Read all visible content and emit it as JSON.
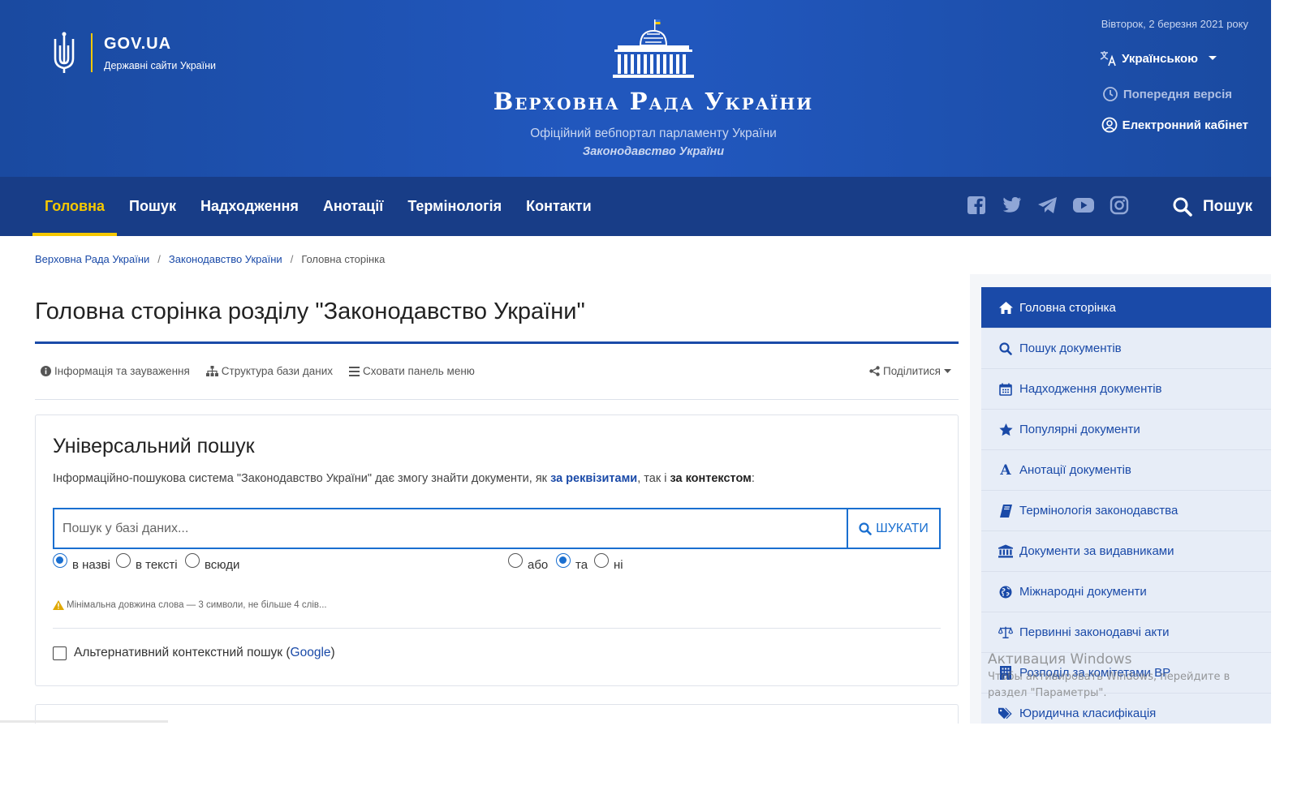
{
  "header": {
    "govua_title": "GOV.UA",
    "govua_subtitle": "Державні сайти України",
    "site_title": "Верховна Рада України",
    "site_subtitle": "Офіційний вебпортал парламенту України",
    "site_section": "Законодавство України",
    "date": "Вівторок, 2 березня 2021 року",
    "language": "Українською",
    "previous_version": "Попередня версія",
    "cabinet": "Електронний кабінет"
  },
  "nav": {
    "items": [
      {
        "label": "Головна",
        "active": true
      },
      {
        "label": "Пошук"
      },
      {
        "label": "Надходження"
      },
      {
        "label": "Анотації"
      },
      {
        "label": "Термінологія"
      },
      {
        "label": "Контакти"
      }
    ],
    "social": [
      "facebook-icon",
      "twitter-icon",
      "telegram-icon",
      "youtube-icon",
      "instagram-icon"
    ],
    "search_label": "Пошук"
  },
  "breadcrumb": [
    "Верховна Рада України",
    "Законодавство України",
    "Головна сторінка"
  ],
  "main": {
    "title": "Головна сторінка розділу \"Законодавство України\"",
    "toolbar": {
      "info": "Інформація та зауваження",
      "structure": "Структура бази даних",
      "hide_menu": "Сховати панель меню",
      "share": "Поділитися"
    },
    "search_card": {
      "heading": "Універсальний пошук",
      "desc_prefix": "Інформаційно-пошукова система \"Законодавство України\" дає змогу знайти документи, як ",
      "desc_link": "за реквізитами",
      "desc_middle": ", так і ",
      "desc_bold": "за контекстом",
      "desc_suffix": ":",
      "placeholder": "Пошук у базі даних...",
      "button": "ШУКАТИ",
      "scope_options": [
        {
          "label": "в назві",
          "checked": true
        },
        {
          "label": "в тексті",
          "checked": false
        },
        {
          "label": "всюди",
          "checked": false
        }
      ],
      "logic_options": [
        {
          "label": "або",
          "checked": false
        },
        {
          "label": "та",
          "checked": true
        },
        {
          "label": "ні",
          "checked": false
        }
      ],
      "hint": "Мінімальна довжина слова — 3 символи, не більше 4 слів...",
      "alt_search_prefix": "Альтернативний контекстний пошук (",
      "alt_search_link": "Google",
      "alt_search_suffix": ")"
    }
  },
  "sidebar": {
    "items": [
      {
        "label": "Головна сторінка",
        "icon": "home-icon",
        "active": true
      },
      {
        "label": "Пошук документів",
        "icon": "search-icon"
      },
      {
        "label": "Надходження документів",
        "icon": "calendar-icon"
      },
      {
        "label": "Популярні документи",
        "icon": "star-icon"
      },
      {
        "label": "Анотації документів",
        "icon": "letter-a-icon"
      },
      {
        "label": "Термінологія законодавства",
        "icon": "book-icon"
      },
      {
        "label": "Документи за видавниками",
        "icon": "institution-icon"
      },
      {
        "label": "Міжнародні документи",
        "icon": "globe-icon"
      },
      {
        "label": "Первинні законодавчі акти",
        "icon": "balance-scale-icon"
      },
      {
        "label": "Розподіл за комітетами ВР",
        "icon": "building-icon"
      },
      {
        "label": "Юридична класифікація",
        "icon": "tags-icon"
      }
    ]
  },
  "overlay": {
    "activation_title": "Активация Windows",
    "activation_text": "Чтобы активировать Windows, перейдите в раздел \"Параметры\"."
  },
  "colors": {
    "header_blue": "#2157bd",
    "nav_blue": "#183d87",
    "accent_yellow": "#f5c800",
    "link_blue": "#1a4aa8"
  }
}
